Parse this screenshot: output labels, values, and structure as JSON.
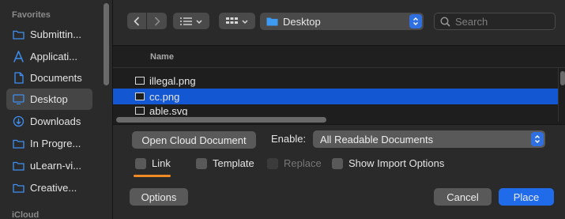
{
  "sidebar": {
    "favorites_heading": "Favorites",
    "icloud_heading": "iCloud",
    "items": [
      {
        "label": "Submittin...",
        "icon": "folder-icon"
      },
      {
        "label": "Applicati...",
        "icon": "applications-icon"
      },
      {
        "label": "Documents",
        "icon": "document-icon"
      },
      {
        "label": "Desktop",
        "icon": "desktop-icon",
        "selected": true
      },
      {
        "label": "Downloads",
        "icon": "download-icon"
      },
      {
        "label": "In Progre...",
        "icon": "folder-icon"
      },
      {
        "label": "uLearn-vi...",
        "icon": "folder-icon"
      },
      {
        "label": "Creative...",
        "icon": "folder-icon"
      }
    ]
  },
  "toolbar": {
    "location": "Desktop",
    "search_placeholder": "Search"
  },
  "file_list": {
    "column_name": "Name",
    "files": [
      {
        "name": "illegal.png",
        "selected": false
      },
      {
        "name": "cc.png",
        "selected": true
      },
      {
        "name": "able.svg",
        "selected": false
      }
    ]
  },
  "options": {
    "open_cloud_label": "Open Cloud Document",
    "enable_label": "Enable:",
    "enable_value": "All Readable Documents",
    "checkboxes": {
      "link": "Link",
      "template": "Template",
      "replace": "Replace",
      "show_import": "Show Import Options"
    },
    "options_button": "Options",
    "cancel_button": "Cancel",
    "place_button": "Place"
  },
  "colors": {
    "accent": "#1f6bea",
    "selection": "#1357d3",
    "link_underline": "#f08a24"
  }
}
